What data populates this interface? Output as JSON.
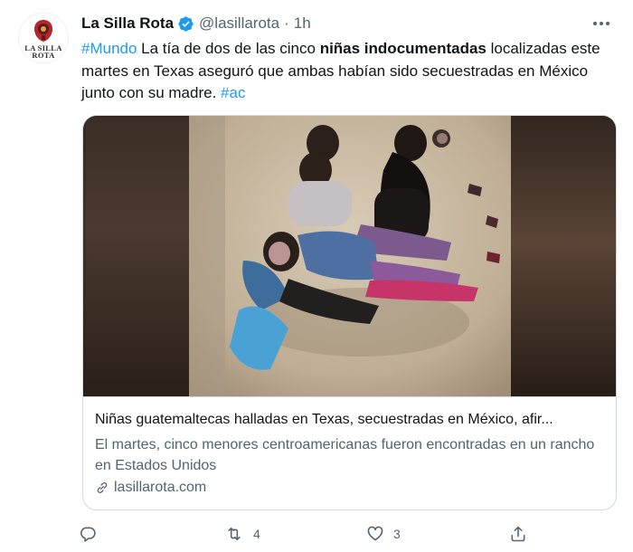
{
  "account": {
    "display_name": "La Silla Rota",
    "handle": "@lasillarota",
    "separator": "·",
    "time": "1h",
    "avatar_text_line1": "LA SILLA",
    "avatar_text_line2": "ROTA"
  },
  "tweet": {
    "hashtag1": "#Mundo",
    "text_part1": " La tía de dos de las cinco ",
    "bold_text": "niñas indocumentadas",
    "text_part2": " localizadas este martes en Texas aseguró que ambas habían sido secuestradas en México junto con su madre. ",
    "hashtag2": "#ac"
  },
  "card": {
    "title": "Niñas guatemaltecas halladas en Texas, secuestradas en México, afir...",
    "description": "El martes, cinco menores centroamericanas fueron encontradas en un rancho en Estados Unidos",
    "domain": "lasillarota.com"
  },
  "actions": {
    "reply_count": "",
    "retweet_count": "4",
    "like_count": "3"
  },
  "colors": {
    "accent": "#1d9bf0",
    "muted": "#536471",
    "text": "#0f1419",
    "border": "#cfd9de"
  },
  "icons": [
    "verified-badge-icon",
    "more-icon",
    "link-icon",
    "reply-icon",
    "retweet-icon",
    "like-icon",
    "share-icon"
  ]
}
